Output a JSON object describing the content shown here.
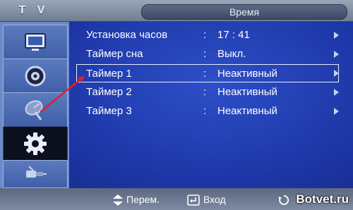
{
  "header": {
    "source_label": "T V",
    "title": "Время"
  },
  "sidebar": {
    "items": [
      {
        "icon": "picture-icon"
      },
      {
        "icon": "sound-icon"
      },
      {
        "icon": "channel-antenna-icon"
      },
      {
        "icon": "setup-gear-icon",
        "active": true
      },
      {
        "icon": "input-connector-icon"
      }
    ]
  },
  "menu": {
    "rows": [
      {
        "label": "Установка часов",
        "colon": ":",
        "value": "17 : 41"
      },
      {
        "label": "Таймер сна",
        "colon": ":",
        "value": "Выкл."
      },
      {
        "label": "Таймер 1",
        "colon": ":",
        "value": "Неактивный",
        "selected": true
      },
      {
        "label": "Таймер 2",
        "colon": ":",
        "value": "Неактивный"
      },
      {
        "label": "Таймер 3",
        "colon": ":",
        "value": "Неактивный"
      }
    ]
  },
  "footer": {
    "move_label": "Перем.",
    "enter_label": "Вход",
    "watermark": "Botvet.ru"
  },
  "colors": {
    "selection_border": "#e8eef8",
    "annotation_arrow": "#e0202a"
  }
}
